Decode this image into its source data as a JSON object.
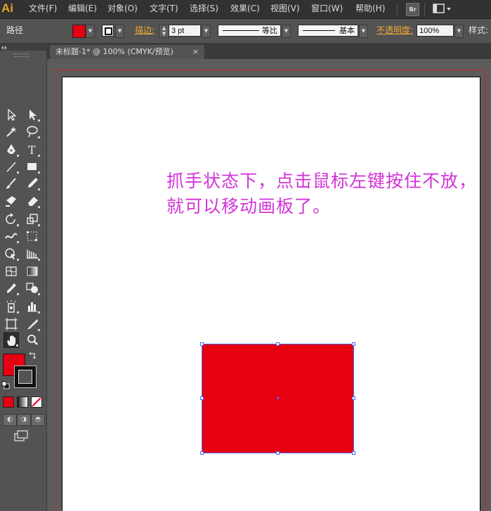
{
  "app": {
    "logo": "Ai"
  },
  "menu": [
    "文件(F)",
    "编辑(E)",
    "对象(O)",
    "文字(T)",
    "选择(S)",
    "效果(C)",
    "视图(V)",
    "窗口(W)",
    "帮助(H)"
  ],
  "menu_right": {
    "bridge_label": "Br"
  },
  "controlbar": {
    "selection_label": "路径",
    "stroke_label": "描边:",
    "stroke_weight": "3 pt",
    "profile_label": "等比",
    "brush_label": "基本",
    "opacity_label": "不透明度:",
    "opacity_value": "100%",
    "style_label": "样式:",
    "fill_color": "#e60012"
  },
  "document": {
    "tab_title": "未标题-1* @ 100% (CMYK/预览)",
    "close_glyph": "×",
    "note_text": "抓手状态下，点击鼠标左键按住不放，就可以移动画板了。",
    "rect_color": "#e60012",
    "note_color": "#d233d8"
  },
  "tools": [
    "selection-tool",
    "direct-selection-tool",
    "magic-wand-tool",
    "lasso-tool",
    "pen-tool",
    "type-tool",
    "line-segment-tool",
    "rectangle-tool",
    "paintbrush-tool",
    "pencil-tool",
    "blob-brush-tool",
    "eraser-tool",
    "rotate-tool",
    "scale-tool",
    "width-tool",
    "free-transform-tool",
    "shape-builder-tool",
    "perspective-grid-tool",
    "mesh-tool",
    "gradient-tool",
    "eyedropper-tool",
    "blend-tool",
    "symbol-sprayer-tool",
    "column-graph-tool",
    "artboard-tool",
    "slice-tool",
    "hand-tool",
    "zoom-tool"
  ],
  "active_tool": "hand-tool"
}
